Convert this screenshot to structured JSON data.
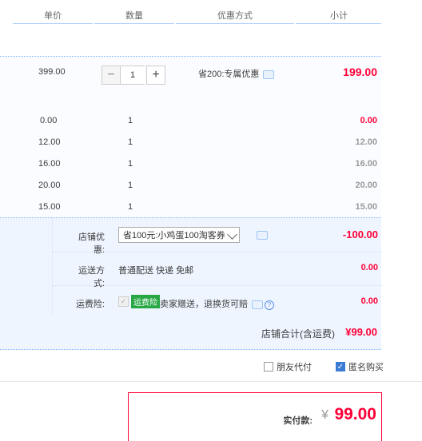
{
  "columns": {
    "price": "单价",
    "quantity": "数量",
    "promotion": "优惠方式",
    "subtotal": "小计"
  },
  "main_item": {
    "price": "399.00",
    "quantity": "1",
    "promotion": "省200:专属优惠",
    "subtotal": "199.00"
  },
  "sub_items": [
    {
      "price": "0.00",
      "quantity": "1",
      "subtotal": "0.00"
    },
    {
      "price": "12.00",
      "quantity": "1",
      "subtotal": "12.00"
    },
    {
      "price": "16.00",
      "quantity": "1",
      "subtotal": "16.00"
    },
    {
      "price": "20.00",
      "quantity": "1",
      "subtotal": "20.00"
    },
    {
      "price": "15.00",
      "quantity": "1",
      "subtotal": "15.00"
    }
  ],
  "store": {
    "discount_label": "店铺优惠:",
    "discount_selected": "省100元:小鸡蛋100淘客券",
    "discount_value": "-100.00",
    "shipping_label": "运送方式:",
    "shipping_text": "普通配送 快递 免邮",
    "shipping_value": "0.00",
    "insurance_label": "运费险:",
    "insurance_badge": "运费险",
    "insurance_text": "卖家赠送，退换货可赔",
    "insurance_value": "0.00",
    "total_label": "店铺合计(含运费)",
    "total_value": "¥99.00"
  },
  "options": {
    "friend_pay": "朋友代付",
    "anonymous": "匿名购买"
  },
  "payment": {
    "label": "实付款:",
    "currency": "¥",
    "amount": "99.00"
  },
  "colors": {
    "accent_red": "#ff0036",
    "border_blue": "#80b2ff",
    "panel_blue": "#eef5ff"
  }
}
